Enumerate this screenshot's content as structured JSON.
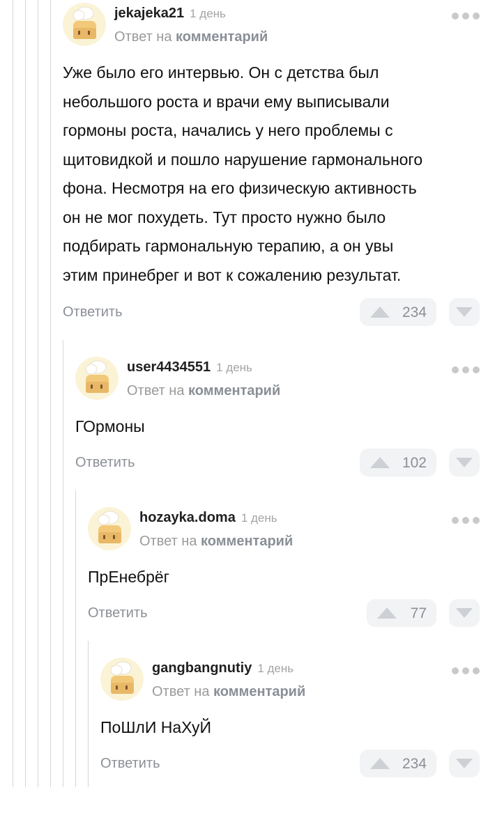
{
  "comments": [
    {
      "username": "jekajeka21",
      "date": "1 день",
      "reply_prefix": "Ответ на",
      "reply_link": "комментарий",
      "lines": [
        "Уже было его интервью. Он с детства был",
        "небольшого роста и врачи ему выписывали",
        "гормоны роста, начались у него проблемы с",
        "щитовидкой и пошло нарушение гармонального",
        "фона. Несмотря на его физическую активность",
        "он не мог похудеть. Тут просто нужно было",
        "подбирать гармональную терапию, а он увы",
        "этим принебрег и вот к сожалению результат."
      ],
      "reply_label": "Ответить",
      "votes": "234",
      "avatar_icon": "chef-toast-avatar-icon"
    },
    {
      "username": "user4434551",
      "date": "1 день",
      "reply_prefix": "Ответ на",
      "reply_link": "комментарий",
      "lines": [
        "ГОрмоны"
      ],
      "reply_label": "Ответить",
      "votes": "102",
      "avatar_icon": "chef-toast-avatar-icon"
    },
    {
      "username": "hozayka.doma",
      "date": "1 день",
      "reply_prefix": "Ответ на",
      "reply_link": "комментарий",
      "lines": [
        "ПрЕнебрёг"
      ],
      "reply_label": "Ответить",
      "votes": "77",
      "avatar_icon": "chef-toast-avatar-icon"
    },
    {
      "username": "gangbangnutiy",
      "date": "1 день",
      "reply_prefix": "Ответ на",
      "reply_link": "комментарий",
      "lines": [
        "ПоШлИ НаХуЙ"
      ],
      "reply_label": "Ответить",
      "votes": "234",
      "avatar_icon": "chef-toast-avatar-icon"
    }
  ],
  "icons": {
    "more": "more-dots-icon",
    "upvote": "upvote-arrow-icon",
    "downvote": "downvote-arrow-icon"
  },
  "colors": {
    "link": "#8b8f96",
    "meta": "#a4a4a4",
    "vote_bg": "#f2f3f5",
    "thread_line": "#d6d6d6",
    "avatar_bg": "#fbf3d6"
  }
}
